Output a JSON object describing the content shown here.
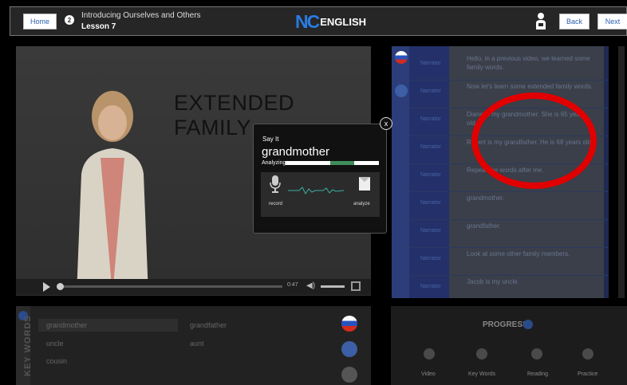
{
  "header": {
    "home_label": "Home",
    "lesson_number": "2",
    "lesson_title": "Introducing Ourselves and Others",
    "lesson_subtitle": "Lesson 7",
    "logo_mark": "NC",
    "logo_text": "ENGLISH",
    "back_label": "Back",
    "next_label": "Next"
  },
  "video": {
    "slide_title": "EXTENDED FAMILY",
    "time": "0:47"
  },
  "transcript": {
    "rows": [
      {
        "speaker": "Narrator",
        "text": "Hello, in a previous video, we learned some family words."
      },
      {
        "speaker": "Narrator",
        "text": "Now let's learn some extended family words."
      },
      {
        "speaker": "Narrator",
        "text": "Diane is my grandmother. She is 65 years old."
      },
      {
        "speaker": "Narrator",
        "text": "Robert is my grandfather. He is 68 years old."
      },
      {
        "speaker": "Narrator",
        "text": "Repeat the words after me."
      },
      {
        "speaker": "Narrator",
        "text": "grandmother."
      },
      {
        "speaker": "Narrator",
        "text": "grandfather."
      },
      {
        "speaker": "Narrator",
        "text": "Look at some other family members."
      },
      {
        "speaker": "Narrator",
        "text": "Jacob is my uncle."
      }
    ]
  },
  "modal": {
    "heading": "Say It",
    "word": "grandmother",
    "status": "Analyzing",
    "record_label": "record",
    "analyze_label": "analyze",
    "close_label": "x"
  },
  "keywords": {
    "side_label": "KEY WORDS",
    "words": [
      "grandmother",
      "grandfather",
      "uncle",
      "aunt",
      "cousin"
    ]
  },
  "progress": {
    "title": "PROGRESS",
    "steps": [
      "Video",
      "Key Words",
      "Reading",
      "Practice"
    ]
  },
  "colors": {
    "accent_blue": "#2a7be0",
    "annotation_red": "#e10000",
    "transcript_bg": "#1f2a52"
  }
}
